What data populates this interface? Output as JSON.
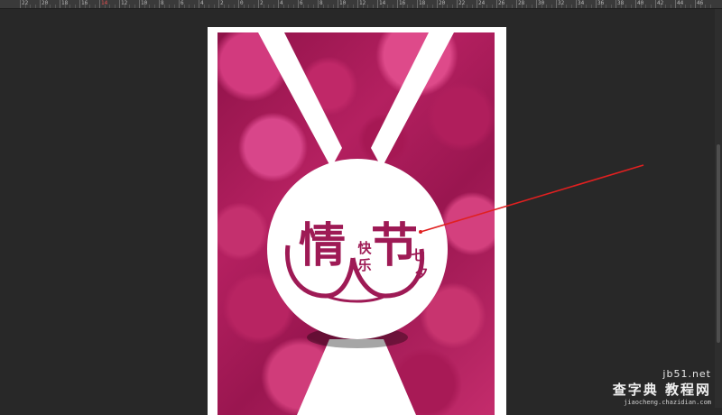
{
  "ruler": {
    "labels": [
      "22",
      "20",
      "18",
      "16",
      "14",
      "12",
      "10",
      "8",
      "6",
      "4",
      "2",
      "0",
      "2",
      "4",
      "6",
      "8",
      "10",
      "12",
      "14",
      "16",
      "18",
      "20",
      "22",
      "24",
      "26",
      "28",
      "30",
      "32",
      "34",
      "36",
      "38",
      "40",
      "42",
      "44",
      "46",
      "48"
    ],
    "highlight_label": "14"
  },
  "poster": {
    "title_left": "情",
    "title_right": "节",
    "sub_left_1": "快",
    "sub_left_2": "乐",
    "sub_right_1": "七",
    "sub_right_2": "夕"
  },
  "watermark": {
    "top": "jb51.net",
    "main": "查字典 教程网",
    "sub": "jiaocheng.chazidian.com"
  },
  "colors": {
    "workspace": "#282828",
    "ruler_bg": "#3a3a3a",
    "petal_base": "#b42060",
    "title_color": "#9e1a55",
    "annotation_line": "#e02020"
  }
}
